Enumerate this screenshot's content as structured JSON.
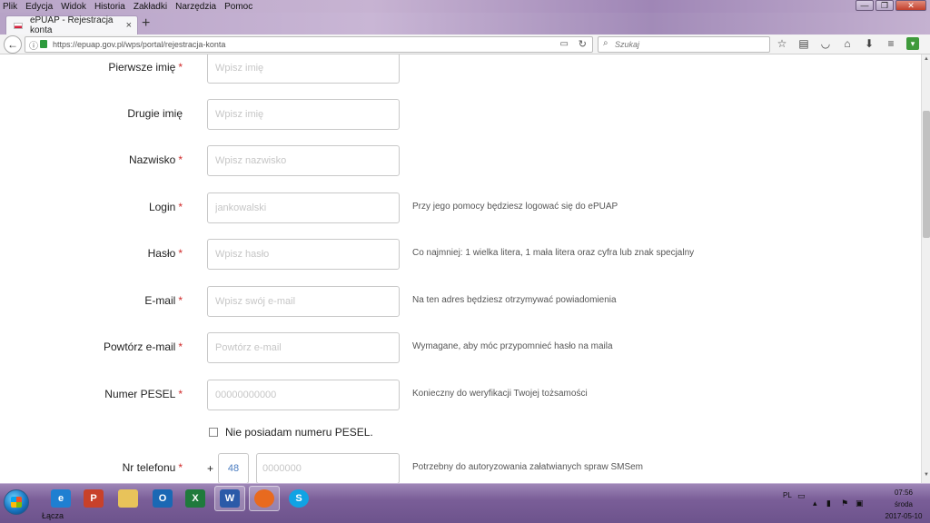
{
  "menubar": {
    "items": [
      "Plik",
      "Edycja",
      "Widok",
      "Historia",
      "Zakładki",
      "Narzędzia",
      "Pomoc"
    ]
  },
  "window_controls": {
    "minimize": "—",
    "maximize": "❐",
    "close": "✕"
  },
  "tab": {
    "title": "ePUAP - Rejestracja konta",
    "close": "×",
    "new_tab": "+"
  },
  "navbar": {
    "back": "←",
    "url_host": "https://epuap.gov.pl",
    "url_path": "/wps/portal/rejestracja-konta",
    "search_placeholder": "Szukaj"
  },
  "form": {
    "first_name": {
      "label": "Pierwsze imię",
      "placeholder": "Wpisz imię",
      "required": "*"
    },
    "second_name": {
      "label": "Drugie imię",
      "placeholder": "Wpisz imię"
    },
    "last_name": {
      "label": "Nazwisko",
      "placeholder": "Wpisz nazwisko",
      "required": "*"
    },
    "login": {
      "label": "Login",
      "placeholder": "jankowalski",
      "required": "*",
      "hint": "Przy jego pomocy będziesz logować się do ePUAP"
    },
    "password": {
      "label": "Hasło",
      "placeholder": "Wpisz hasło",
      "required": "*",
      "hint": "Co najmniej: 1 wielka litera, 1 mała litera oraz cyfra lub znak specjalny"
    },
    "email": {
      "label": "E-mail",
      "placeholder": "Wpisz swój e-mail",
      "required": "*",
      "hint": "Na ten adres będziesz otrzymywać powiadomienia"
    },
    "email_repeat": {
      "label": "Powtórz e-mail",
      "placeholder": "Powtórz e-mail",
      "required": "*",
      "hint": "Wymagane, aby móc przypomnieć hasło na maila"
    },
    "pesel": {
      "label": "Numer PESEL",
      "placeholder": "00000000000",
      "required": "*",
      "hint": "Konieczny do weryfikacji Twojej tożsamości"
    },
    "no_pesel": {
      "label": "Nie posiadam numeru PESEL."
    },
    "phone": {
      "label": "Nr telefonu",
      "required": "*",
      "plus": "+",
      "country_code": "48",
      "placeholder": "0000000",
      "hint": "Potrzebny do autoryzowania załatwianych spraw SMSem"
    }
  },
  "taskbar": {
    "start_label": "Łącza",
    "apps": [
      {
        "name": "ie",
        "glyph": "e",
        "color": "#1f7fd1"
      },
      {
        "name": "powerpoint",
        "glyph": "P",
        "color": "#c8412a"
      },
      {
        "name": "explorer",
        "glyph": "",
        "color": "#e8c35a"
      },
      {
        "name": "outlook",
        "glyph": "O",
        "color": "#1a68b4"
      },
      {
        "name": "excel",
        "glyph": "X",
        "color": "#1f7a3c"
      },
      {
        "name": "word",
        "glyph": "W",
        "color": "#2b5aa8"
      },
      {
        "name": "firefox",
        "glyph": "",
        "color": "#e86a1f"
      },
      {
        "name": "skype",
        "glyph": "S",
        "color": "#10a3e4"
      }
    ],
    "lang": "PL",
    "time": "07:56",
    "day": "środa",
    "date": "2017-05-10"
  }
}
